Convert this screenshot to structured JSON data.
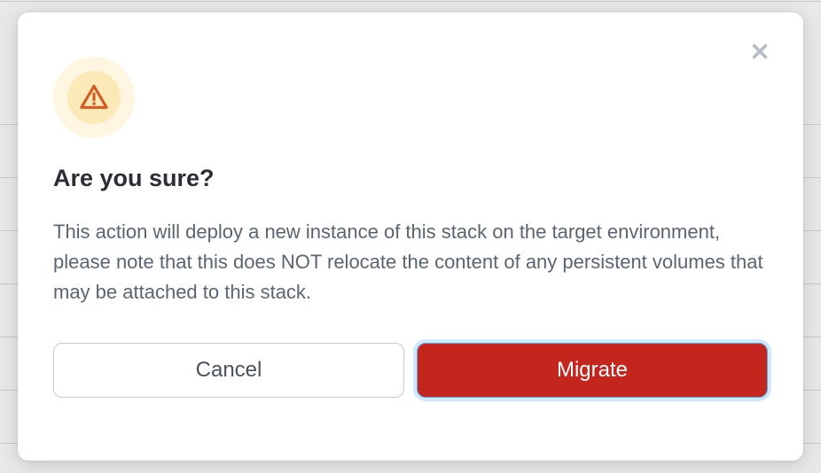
{
  "modal": {
    "title": "Are you sure?",
    "body": "This action will deploy a new instance of this stack on the target environment, please note that this does NOT relocate the content of any persistent volumes that may be attached to this stack.",
    "cancel_label": "Cancel",
    "confirm_label": "Migrate"
  },
  "icons": {
    "warning": "warning-triangle-icon",
    "close": "close-icon"
  },
  "colors": {
    "confirm_bg": "#c4261d",
    "warning_accent": "#d65a1f",
    "warning_bg_outer": "#fef6e0",
    "warning_bg_inner": "#fce9b8"
  }
}
